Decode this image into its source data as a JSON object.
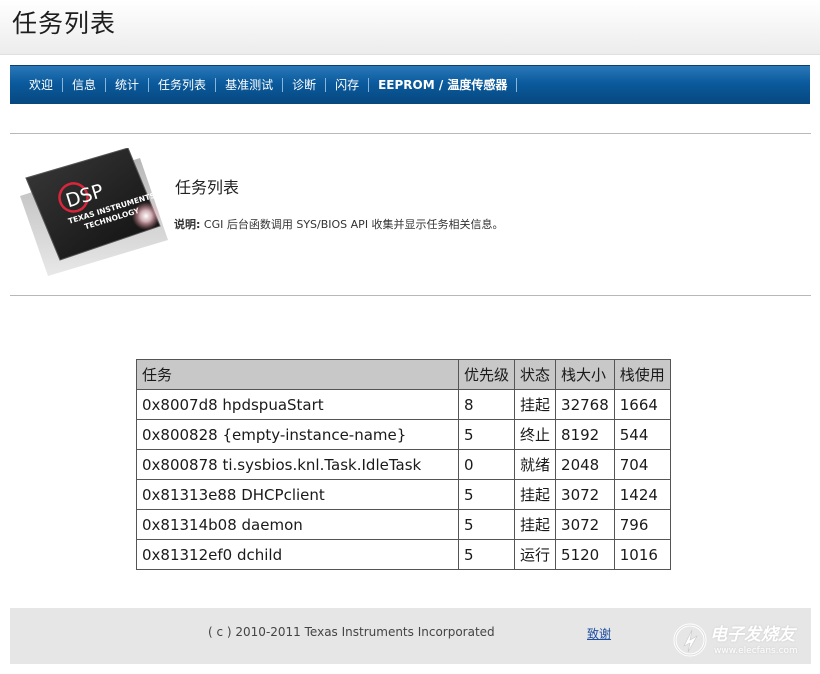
{
  "header": {
    "title": "任务列表"
  },
  "nav": {
    "items": [
      {
        "label": "欢迎"
      },
      {
        "label": "信息"
      },
      {
        "label": "统计"
      },
      {
        "label": "任务列表"
      },
      {
        "label": "基准测试"
      },
      {
        "label": "诊断"
      },
      {
        "label": "闪存"
      },
      {
        "label": "EEPROM / 温度传感器"
      }
    ]
  },
  "info": {
    "logo_text": "DSP",
    "logo_sub1": "TEXAS INSTRUMENTS",
    "logo_sub2": "TECHNOLOGY",
    "title": "任务列表",
    "desc_label": "说明:",
    "desc_text": " CGI 后台函数调用 SYS/BIOS API 收集并显示任务相关信息。"
  },
  "table": {
    "headers": [
      "任务",
      "优先级",
      "状态",
      "栈大小",
      "栈使用"
    ],
    "rows": [
      [
        "0x8007d8 hpdspuaStart",
        "8",
        "挂起",
        "32768",
        "1664"
      ],
      [
        "0x800828 {empty-instance-name}",
        "5",
        "终止",
        "8192",
        "544"
      ],
      [
        "0x800878 ti.sysbios.knl.Task.IdleTask",
        "0",
        "就绪",
        "2048",
        "704"
      ],
      [
        "0x81313e88 DHCPclient",
        "5",
        "挂起",
        "3072",
        "1424"
      ],
      [
        "0x81314b08 daemon",
        "5",
        "挂起",
        "3072",
        "796"
      ],
      [
        "0x81312ef0 dchild",
        "5",
        "运行",
        "5120",
        "1016"
      ]
    ]
  },
  "footer": {
    "copyright": "( c ) 2010-2011 Texas Instruments Incorporated",
    "thanks": "致谢"
  },
  "watermark": {
    "text": "电子发烧友",
    "url": "www.elecfans.com"
  },
  "colors": {
    "nav_bg": "#0a5a9d",
    "table_header_bg": "#c8c8c8",
    "footer_bg": "#e6e6e6",
    "link": "#1f4fa0"
  }
}
